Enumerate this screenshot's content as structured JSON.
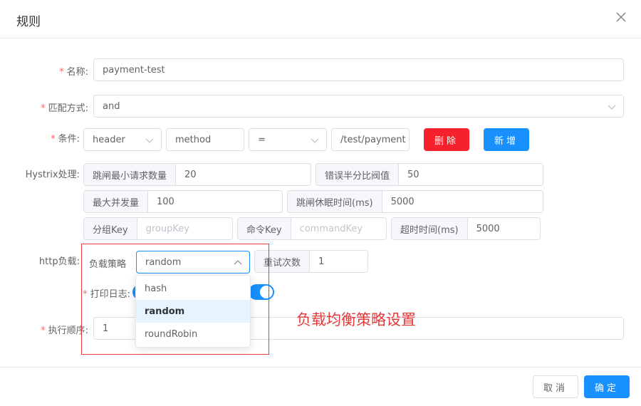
{
  "dialog": {
    "title": "规则",
    "close_icon": "close-icon"
  },
  "form": {
    "name": {
      "label": "名称:",
      "value": "payment-test"
    },
    "match": {
      "label": "匹配方式:",
      "value": "and"
    },
    "condition": {
      "label": "条件:",
      "type": "header",
      "field": "method",
      "operator": "=",
      "value": "/test/payment",
      "delete_label": "删除",
      "add_label": "新增"
    },
    "hystrix": {
      "label": "Hystrix处理:",
      "min_requests_label": "跳闸最小请求数量",
      "min_requests_value": "20",
      "error_threshold_label": "错误半分比阀值",
      "error_threshold_value": "50",
      "max_concurrency_label": "最大并发量",
      "max_concurrency_value": "100",
      "sleep_window_label": "跳闸休眠时间(ms)",
      "sleep_window_value": "5000",
      "group_key_label": "分组Key",
      "group_key_placeholder": "groupKey",
      "command_key_label": "命令Key",
      "command_key_placeholder": "commandKey",
      "timeout_label": "超时时间(ms)",
      "timeout_value": "5000"
    },
    "http_load": {
      "label": "http负载:",
      "strategy_label": "负载策略",
      "strategy_value": "random",
      "retry_label": "重试次数",
      "retry_value": "1",
      "options": [
        "hash",
        "random",
        "roundRobin"
      ]
    },
    "log": {
      "label": "打印日志:",
      "enabled": true
    },
    "order": {
      "label": "执行顺序:",
      "value": "1"
    }
  },
  "annotation": {
    "text": "负载均衡策略设置"
  },
  "footer": {
    "cancel_label": "取消",
    "ok_label": "确定"
  },
  "colors": {
    "primary": "#1890ff",
    "danger": "#f5222d",
    "annotation": "#e03a3a"
  }
}
